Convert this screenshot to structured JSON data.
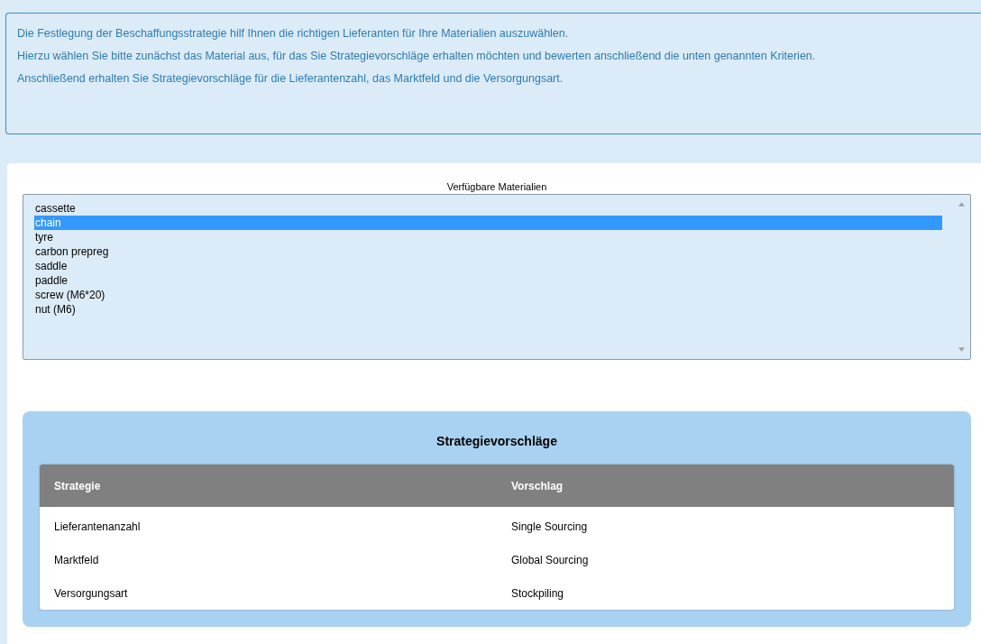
{
  "intro": {
    "paragraphs": [
      "Die Festlegung der Beschaffungsstrategie hilf Ihnen die richtigen Lieferanten für Ihre Materialien auszuwählen.",
      "Hierzu wählen Sie bitte zunächst das Material aus, für das Sie Strategievorschläge erhalten möchten und bewerten anschließend die unten genannten Kriterien.",
      "Anschließend erhalten Sie Strategievorschläge für die Lieferantenzahl, das Marktfeld und die Versorgungsart."
    ]
  },
  "materials": {
    "label": "Verfügbare Materialien",
    "items": [
      {
        "text": "cassette",
        "selected": false
      },
      {
        "text": "chain",
        "selected": true
      },
      {
        "text": "tyre",
        "selected": false
      },
      {
        "text": "carbon prepreg",
        "selected": false
      },
      {
        "text": "saddle",
        "selected": false
      },
      {
        "text": "paddle",
        "selected": false
      },
      {
        "text": "screw (M6*20)",
        "selected": false
      },
      {
        "text": "nut (M6)",
        "selected": false
      }
    ]
  },
  "strategy": {
    "title": "Strategievorschläge",
    "columns": [
      "Strategie",
      "Vorschlag"
    ],
    "rows": [
      [
        "Lieferantenanzahl",
        "Single Sourcing"
      ],
      [
        "Marktfeld",
        "Global Sourcing"
      ],
      [
        "Versorgungsart",
        "Stockpiling"
      ]
    ]
  }
}
